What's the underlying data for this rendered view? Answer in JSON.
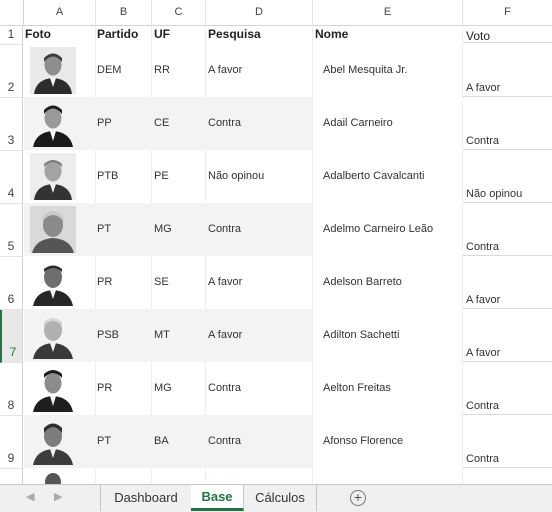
{
  "column_headers": [
    "A",
    "B",
    "C",
    "D",
    "E",
    "F"
  ],
  "header_row": {
    "row_number": "1",
    "foto": "Foto",
    "partido": "Partido",
    "uf": "UF",
    "pesquisa": "Pesquisa",
    "nome": "Nome",
    "voto": "Voto"
  },
  "rows": [
    {
      "row_number": "2",
      "partido": "DEM",
      "uf": "RR",
      "pesquisa": "A favor",
      "nome": "Abel Mesquita Jr.",
      "voto": "A favor"
    },
    {
      "row_number": "3",
      "partido": "PP",
      "uf": "CE",
      "pesquisa": "Contra",
      "nome": "Adail Carneiro",
      "voto": "Contra"
    },
    {
      "row_number": "4",
      "partido": "PTB",
      "uf": "PE",
      "pesquisa": "Não opinou",
      "nome": "Adalberto Cavalcanti",
      "voto": "Não opinou"
    },
    {
      "row_number": "5",
      "partido": "PT",
      "uf": "MG",
      "pesquisa": "Contra",
      "nome": "Adelmo Carneiro Leão",
      "voto": "Contra"
    },
    {
      "row_number": "6",
      "partido": "PR",
      "uf": "SE",
      "pesquisa": "A favor",
      "nome": "Adelson Barreto",
      "voto": "A favor"
    },
    {
      "row_number": "7",
      "partido": "PSB",
      "uf": "MT",
      "pesquisa": "A favor",
      "nome": "Adilton Sachetti",
      "voto": "A favor"
    },
    {
      "row_number": "8",
      "partido": "PR",
      "uf": "MG",
      "pesquisa": "Contra",
      "nome": "Aelton Freitas",
      "voto": "Contra"
    },
    {
      "row_number": "9",
      "partido": "PT",
      "uf": "BA",
      "pesquisa": "Contra",
      "nome": "Afonso Florence",
      "voto": "Contra"
    }
  ],
  "active_row": "7",
  "sheet_tabs": [
    "Dashboard",
    "Base",
    "Cálculos"
  ],
  "active_tab": "Base",
  "nav_prev": "◀",
  "nav_next": "▶",
  "add_sheet": "+",
  "accent_color": "#217346"
}
